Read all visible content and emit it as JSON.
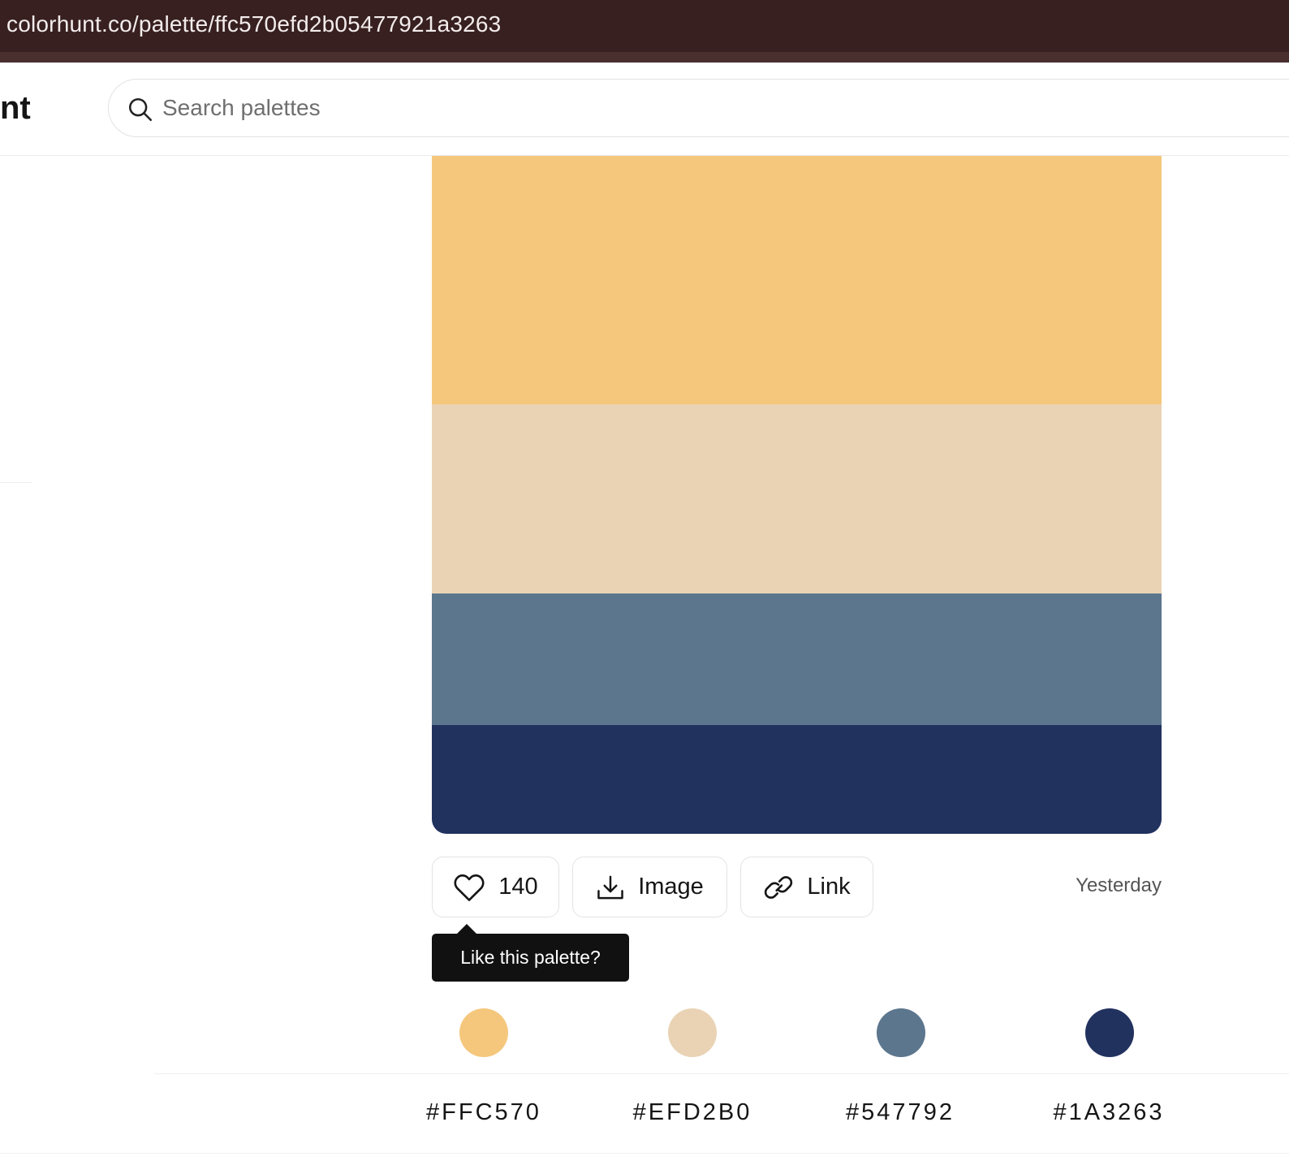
{
  "browser": {
    "url": "colorhunt.co/palette/ffc570efd2b05477921a3263"
  },
  "header": {
    "logo_text": "nt",
    "search": {
      "placeholder": "Search palettes",
      "value": "",
      "icon": "search-icon"
    }
  },
  "palette": {
    "colors": [
      "#F5C77C",
      "#E9D3B4",
      "#5C768E",
      "#22325F"
    ]
  },
  "actions": {
    "like": {
      "count": "140",
      "icon": "heart-icon"
    },
    "image": {
      "label": "Image",
      "icon": "download-icon"
    },
    "link": {
      "label": "Link",
      "icon": "link-icon"
    },
    "date": "Yesterday"
  },
  "tooltip": {
    "text": "Like this palette?"
  },
  "swatches": [
    {
      "color": "#F5C77C",
      "hex": "#FFC570"
    },
    {
      "color": "#E9D3B4",
      "hex": "#EFD2B0"
    },
    {
      "color": "#5C768E",
      "hex": "#547792"
    },
    {
      "color": "#22325F",
      "hex": "#1A3263"
    }
  ]
}
